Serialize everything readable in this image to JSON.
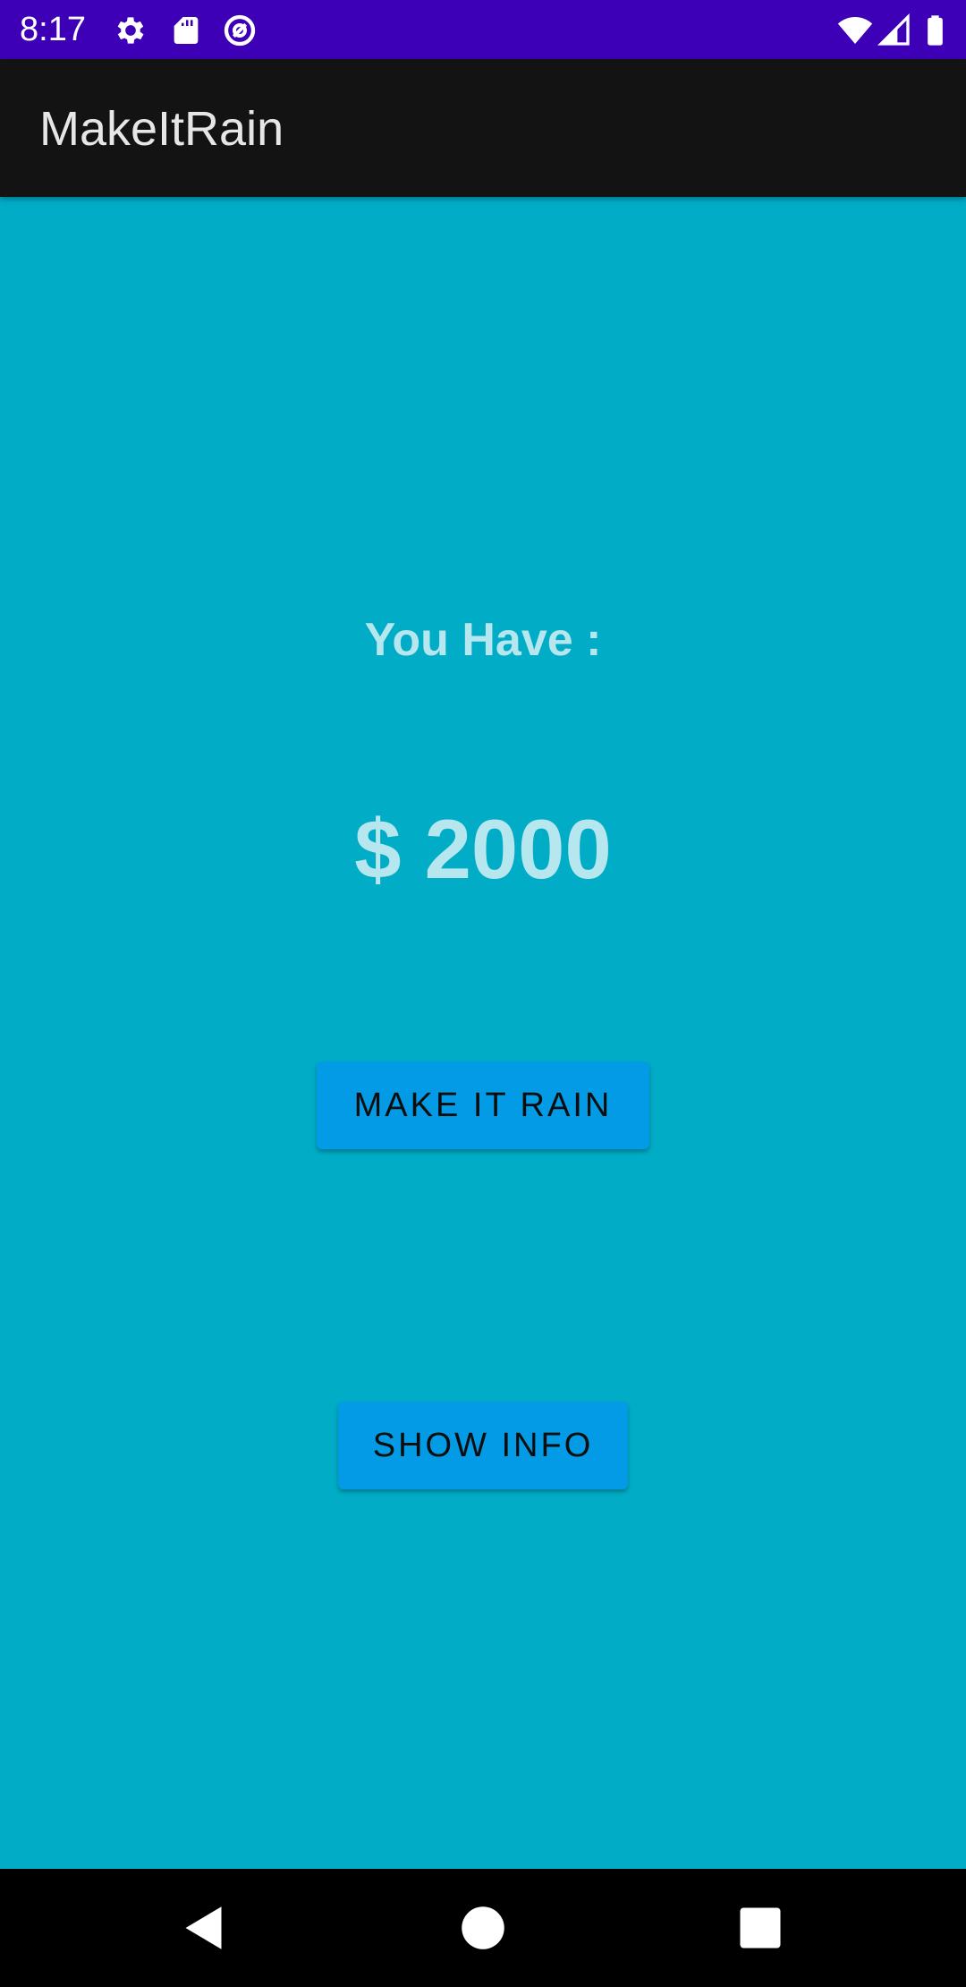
{
  "status_bar": {
    "time": "8:17",
    "left_icons": [
      "gear-icon",
      "sd-card-icon",
      "at-sign-icon"
    ],
    "right_icons": [
      "wifi-icon",
      "signal-icon",
      "battery-icon"
    ],
    "background": "#3e00b7"
  },
  "app_bar": {
    "title": "MakeItRain",
    "background": "#131313"
  },
  "main": {
    "background": "#00acc6",
    "label": "You Have :",
    "amount": "$ 2000",
    "text_color": "#b6e6ee",
    "make_it_rain_label": "MAKE IT RAIN",
    "show_info_label": "SHOW INFO",
    "button_color": "#039be5"
  },
  "nav_bar": {
    "buttons": [
      "back-icon",
      "home-icon",
      "recents-icon"
    ]
  }
}
